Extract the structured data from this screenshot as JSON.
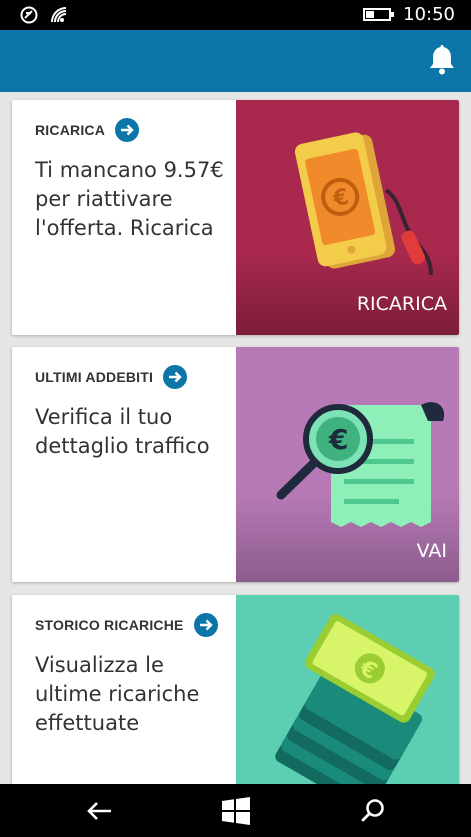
{
  "status_bar": {
    "time": "10:50",
    "icons": [
      "notification-icon",
      "wifi-icon",
      "battery-icon"
    ],
    "battery_level": 0.35
  },
  "header": {
    "icons": [
      "bell-icon"
    ],
    "accent_color": "#0b75a8"
  },
  "cards": [
    {
      "kicker": "RICARICA",
      "description": "Ti mancano 9.57€ per riattivare l'offerta. Ricarica",
      "art_label": "RICARICA",
      "art_icon": "phone-recharge-icon",
      "art_color": "#a8294d"
    },
    {
      "kicker": "ULTIMI ADDEBITI",
      "description": "Verifica il tuo dettaglio traffico",
      "art_label": "VAI",
      "art_icon": "receipt-magnifier-icon",
      "art_color": "#b77ab6"
    },
    {
      "kicker": "STORICO RICARICHE",
      "description": "Visualizza le ultime ricariche effettuate",
      "art_label": "",
      "art_icon": "phone-stack-icon",
      "art_color": "#5ccfb2"
    }
  ],
  "nav_bar": {
    "icons": [
      "back-icon",
      "windows-icon",
      "search-icon"
    ]
  }
}
